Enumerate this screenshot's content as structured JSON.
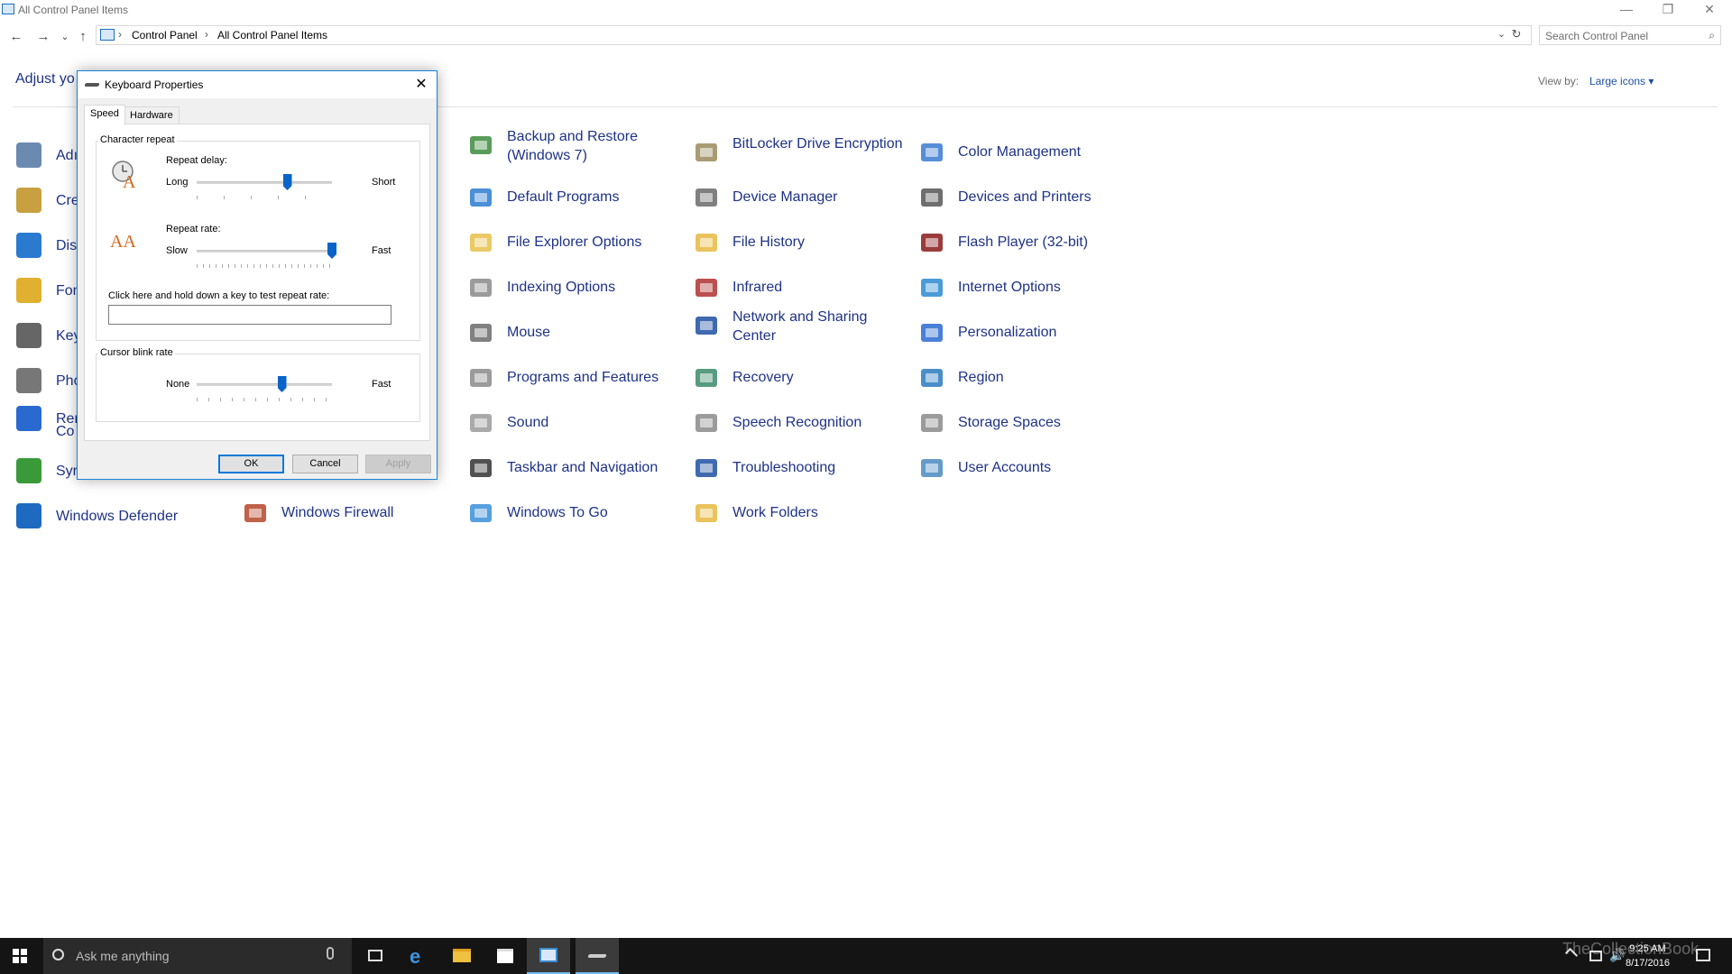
{
  "window": {
    "title": "All Control Panel Items",
    "controls": {
      "minimize": "—",
      "restore": "❐",
      "close": "✕"
    }
  },
  "nav": {
    "back": "←",
    "forward": "→",
    "recent": "⌄",
    "up": "↑",
    "breadcrumb": [
      "Control Panel",
      "All Control Panel Items"
    ],
    "refresh": "↻",
    "search_placeholder": "Search Control Panel"
  },
  "header": {
    "title": "Adjust yo",
    "view_by_label": "View by:",
    "view_by_value": "Large icons ▾"
  },
  "items_col1": [
    "Adı",
    "Cre",
    "Dis",
    "Fon",
    "Key",
    "Pho",
    "Rer",
    "Co",
    "Syr",
    "Windows Defender"
  ],
  "items": [
    {
      "label": "Windows Firewall",
      "icon": "firewall-icon",
      "color": "#b5452a"
    },
    {
      "label": "Backup and Restore (Windows 7)",
      "icon": "backup-icon",
      "color": "#3d8b3d"
    },
    {
      "label": "Default Programs",
      "icon": "default-programs-icon",
      "color": "#2c7bd0"
    },
    {
      "label": "File Explorer Options",
      "icon": "folder-options-icon",
      "color": "#e8c04a"
    },
    {
      "label": "Indexing Options",
      "icon": "indexing-icon",
      "color": "#8a8a8a"
    },
    {
      "label": "Mouse",
      "icon": "mouse-icon",
      "color": "#6b6b6b"
    },
    {
      "label": "Programs and Features",
      "icon": "programs-icon",
      "color": "#8a8a8a"
    },
    {
      "label": "Sound",
      "icon": "sound-icon",
      "color": "#9a9a9a"
    },
    {
      "label": "Taskbar and Navigation",
      "icon": "taskbar-icon",
      "color": "#333333"
    },
    {
      "label": "Windows To Go",
      "icon": "windows-to-go-icon",
      "color": "#3a8fd8"
    },
    {
      "label": "BitLocker Drive Encryption",
      "icon": "bitlocker-icon",
      "color": "#9a8a5a"
    },
    {
      "label": "Device Manager",
      "icon": "device-manager-icon",
      "color": "#6a6a6a"
    },
    {
      "label": "File History",
      "icon": "file-history-icon",
      "color": "#e8b840"
    },
    {
      "label": "Infrared",
      "icon": "infrared-icon",
      "color": "#b03030"
    },
    {
      "label": "Network and Sharing Center",
      "icon": "network-icon",
      "color": "#1e50a2"
    },
    {
      "label": "Recovery",
      "icon": "recovery-icon",
      "color": "#3a8a6a"
    },
    {
      "label": "Speech Recognition",
      "icon": "microphone-icon",
      "color": "#8a8a8a"
    },
    {
      "label": "Troubleshooting",
      "icon": "troubleshooting-icon",
      "color": "#1e50a2"
    },
    {
      "label": "Work Folders",
      "icon": "work-folders-icon",
      "color": "#e8b840"
    },
    {
      "label": "Color Management",
      "icon": "color-management-icon",
      "color": "#3a7ad0"
    },
    {
      "label": "Devices and Printers",
      "icon": "printer-icon",
      "color": "#555555"
    },
    {
      "label": "Flash Player (32-bit)",
      "icon": "flash-icon",
      "color": "#8a1a1a"
    },
    {
      "label": "Internet Options",
      "icon": "internet-options-icon",
      "color": "#2a8ad0"
    },
    {
      "label": "Personalization",
      "icon": "personalization-icon",
      "color": "#2a6ad0"
    },
    {
      "label": "Region",
      "icon": "region-icon",
      "color": "#2a7ac0"
    },
    {
      "label": "Storage Spaces",
      "icon": "storage-icon",
      "color": "#8a8a8a"
    },
    {
      "label": "User Accounts",
      "icon": "user-accounts-icon",
      "color": "#4a8ac0"
    }
  ],
  "dialog": {
    "title": "Keyboard Properties",
    "close": "✕",
    "tabs": [
      "Speed",
      "Hardware"
    ],
    "character_repeat": {
      "group_label": "Character repeat",
      "repeat_delay_label": "Repeat delay:",
      "repeat_delay_min": "Long",
      "repeat_delay_max": "Short",
      "repeat_delay_value": 0.67,
      "repeat_rate_label": "Repeat rate:",
      "repeat_rate_min": "Slow",
      "repeat_rate_max": "Fast",
      "repeat_rate_value": 1.0,
      "test_label": "Click here and hold down a key to test repeat rate:",
      "test_value": ""
    },
    "cursor_blink": {
      "group_label": "Cursor blink rate",
      "min": "None",
      "max": "Fast",
      "value": 0.63
    },
    "buttons": {
      "ok": "OK",
      "cancel": "Cancel",
      "apply": "Apply"
    }
  },
  "taskbar": {
    "search_placeholder": "Ask me anything",
    "time": "9:25 AM",
    "date": "8/17/2016"
  },
  "watermark": "TheCollectionBook",
  "colors": {
    "accent": "#0078d7",
    "link": "#1e3287",
    "taskbar": "#141414"
  }
}
